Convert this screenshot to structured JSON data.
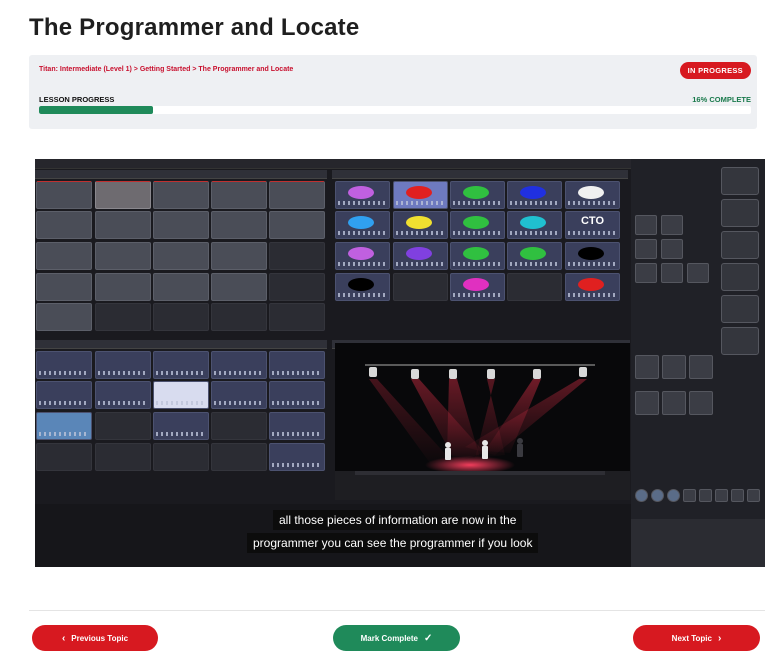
{
  "page": {
    "title": "The Programmer and Locate"
  },
  "breadcrumb": {
    "items": [
      "Titan: Intermediate (Level 1)",
      "Getting Started",
      "The Programmer and Locate"
    ],
    "separator": ">"
  },
  "status": {
    "label": "IN PROGRESS",
    "color": "#d71920"
  },
  "lesson_progress": {
    "label": "LESSON PROGRESS",
    "percent": 16,
    "complete_label": "16% COMPLETE",
    "bar_color": "#1f8a5a"
  },
  "video": {
    "subtitle_line1": "all those pieces of information are now in the",
    "subtitle_line2": "programmer you can see the programmer if you look",
    "tiles": {
      "colours_cto": "CTO"
    }
  },
  "nav": {
    "previous_label": "Previous Topic",
    "mark_complete_label": "Mark Complete",
    "next_label": "Next Topic"
  },
  "icons": {
    "previous": "chevron-left-icon",
    "mark_complete": "check-icon",
    "next": "chevron-right-icon"
  },
  "colors": {
    "accent_red": "#d71920",
    "accent_green": "#1f8a5a"
  }
}
